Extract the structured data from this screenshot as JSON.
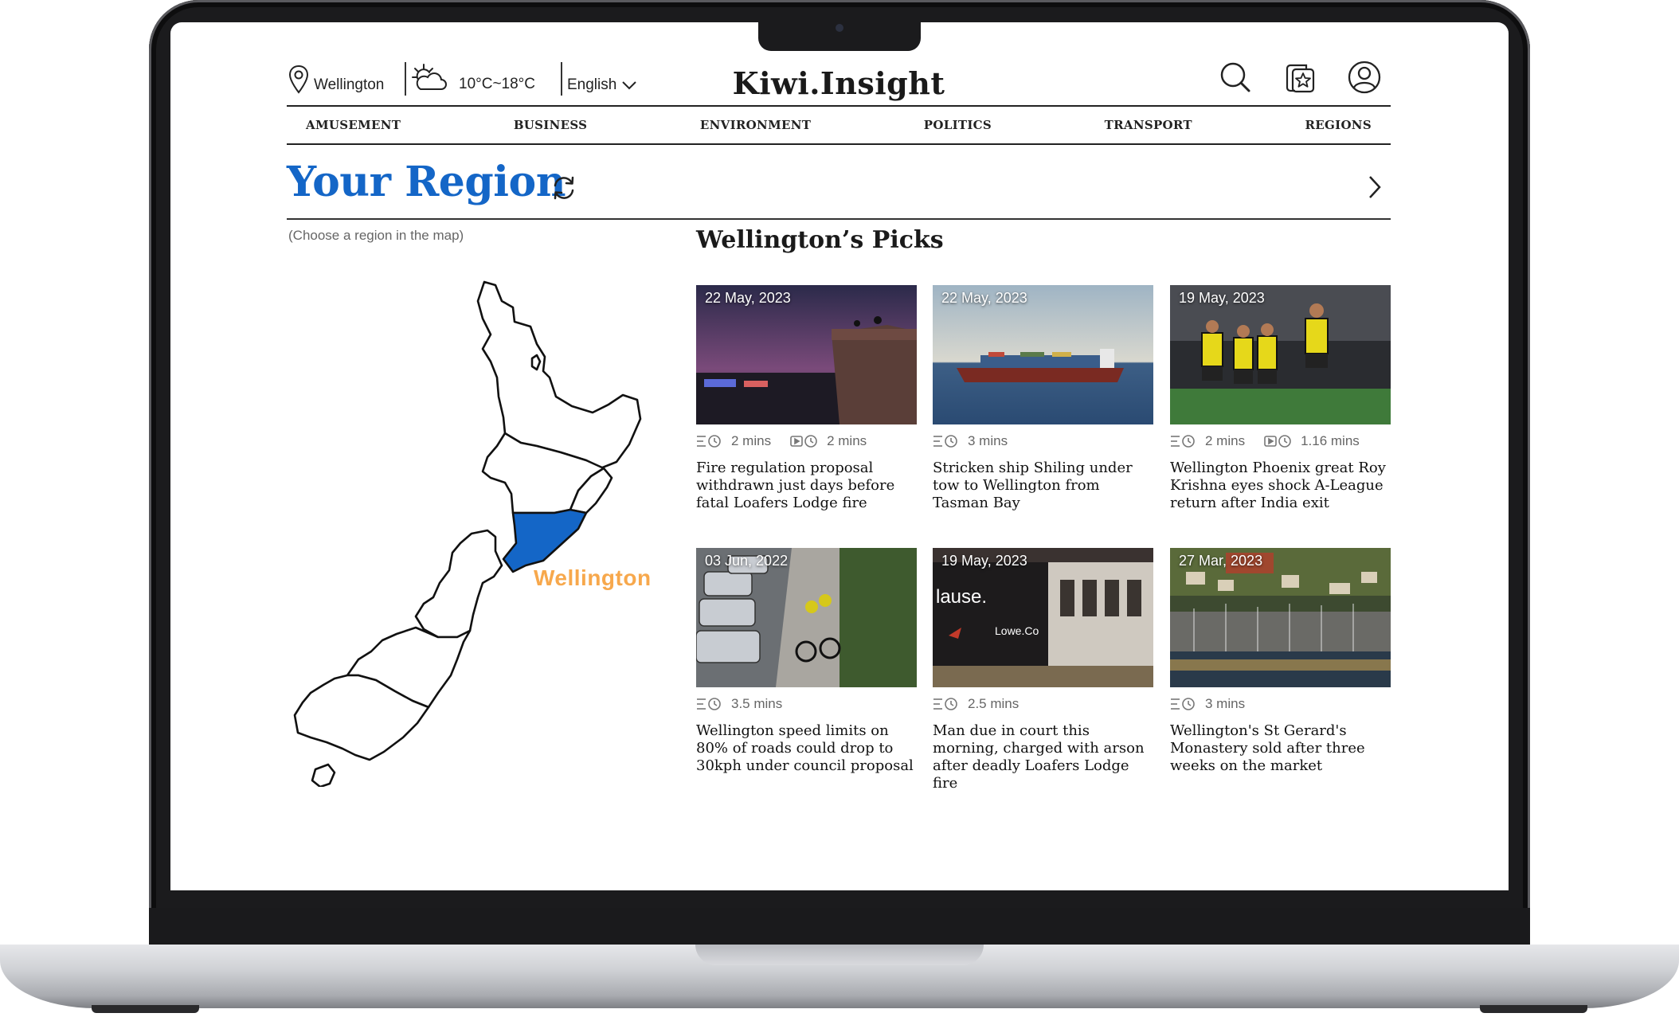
{
  "header": {
    "location": "Wellington",
    "weather": "10°C~18°C",
    "language": "English",
    "logo": "Kiwi.Insight",
    "icons": [
      "location-pin-icon",
      "partly-cloudy-icon",
      "chevron-down-icon",
      "search-icon",
      "favorites-icon",
      "user-account-icon"
    ]
  },
  "nav": {
    "items": [
      "AMUSEMENT",
      "BUSINESS",
      "ENVIRONMENT",
      "POLITICS",
      "TRANSPORT",
      "REGIONS"
    ]
  },
  "region": {
    "title": "Your Region",
    "hint": "(Choose a region in the map)",
    "selected_label": "Wellington",
    "highlight_color": "#1466c7",
    "label_color": "#f7a84c"
  },
  "picks": {
    "title": "Wellington’s Picks",
    "articles": [
      {
        "date": "22 May, 2023",
        "read_time": "2 mins",
        "video_time": "2 mins",
        "headline": "Fire regulation proposal withdrawn just days before fatal Loafers Lodge fire"
      },
      {
        "date": "22 May, 2023",
        "read_time": "3 mins",
        "video_time": "",
        "headline": "Stricken ship Shiling under tow to Wellington from Tasman Bay"
      },
      {
        "date": "19 May, 2023",
        "read_time": "2 mins",
        "video_time": "1.16 mins",
        "headline": "Wellington Phoenix great Roy Krishna eyes shock A-League return after India exit"
      },
      {
        "date": "03 Jun, 2022",
        "read_time": "3.5 mins",
        "video_time": "",
        "headline": "Wellington speed limits on 80% of roads could drop to 30kph under council proposal"
      },
      {
        "date": "19 May, 2023",
        "read_time": "2.5 mins",
        "video_time": "",
        "headline": "Man due in court this morning, charged with arson after deadly Loafers Lodge fire",
        "image_text": [
          "lause.",
          "Lowe.Co"
        ]
      },
      {
        "date": "27 Mar, 2023",
        "read_time": "3 mins",
        "video_time": "",
        "headline": "Wellington's St Gerard's Monastery sold after three weeks on the market"
      }
    ]
  }
}
